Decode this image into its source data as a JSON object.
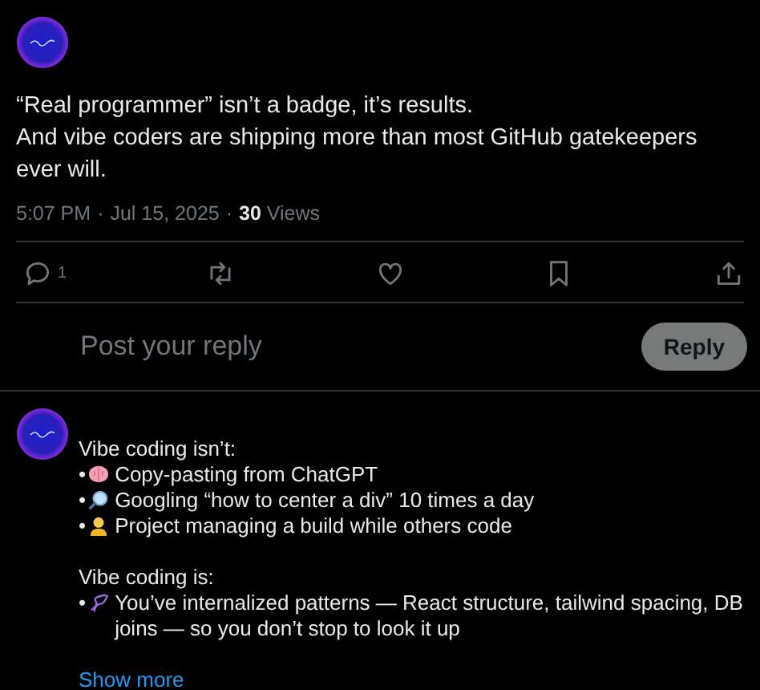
{
  "post": {
    "lines": [
      "“Real programmer” isn’t a badge, it’s results.",
      "And vibe coders are shipping more than most GitHub gatekeepers ever will."
    ],
    "time": "5:07 PM",
    "date": "Jul 15, 2025",
    "separator": "·",
    "views_count": "30",
    "views_label": "Views"
  },
  "actions": [
    {
      "kind": "reply",
      "count": "1"
    },
    {
      "kind": "repost"
    },
    {
      "kind": "like"
    },
    {
      "kind": "bookmark"
    },
    {
      "kind": "share"
    }
  ],
  "composer": {
    "placeholder": "Post your reply",
    "button": "Reply"
  },
  "reply": {
    "blocks": [
      {
        "heading": "Vibe coding isn’t:",
        "items": [
          {
            "bullet": "•",
            "kind": "brain",
            "text": "Copy-pasting from ChatGPT"
          },
          {
            "bullet": "•",
            "kind": "magnifier",
            "text": "Googling “how to center a div” 10 times a day"
          },
          {
            "bullet": "•",
            "kind": "person",
            "text": "Project managing a build while others code"
          }
        ]
      },
      {
        "heading": "Vibe coding is:",
        "items": [
          {
            "bullet": "•",
            "kind": "dna",
            "text": "You’ve internalized patterns — React structure, tailwind spacing, DB joins — so you don’t stop to look it up"
          }
        ]
      }
    ],
    "show_more": "Show more"
  }
}
